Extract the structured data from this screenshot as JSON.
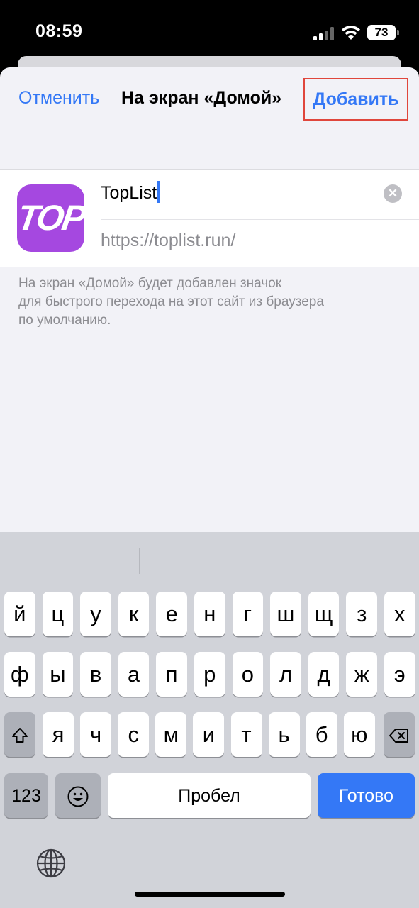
{
  "status_bar": {
    "time": "08:59",
    "battery": "73",
    "signal_icon": "signal-bars-icon",
    "wifi_icon": "wifi-icon"
  },
  "nav": {
    "cancel_label": "Отменить",
    "title": "На экран «Домой»",
    "add_label": "Добавить"
  },
  "form": {
    "app_icon_text": "TOP",
    "app_icon_color": "#a548e0",
    "name_value": "TopList",
    "url": "https://toplist.run/"
  },
  "note_lines": [
    "На экран «Домой» будет добавлен значок",
    "для быстрого перехода на этот сайт из браузера",
    "по умолчанию."
  ],
  "keyboard": {
    "row1": [
      "й",
      "ц",
      "у",
      "к",
      "е",
      "н",
      "г",
      "ш",
      "щ",
      "з",
      "х"
    ],
    "row2": [
      "ф",
      "ы",
      "в",
      "а",
      "п",
      "р",
      "о",
      "л",
      "д",
      "ж",
      "э"
    ],
    "row3": [
      "я",
      "ч",
      "с",
      "м",
      "и",
      "т",
      "ь",
      "б",
      "ю"
    ],
    "numbers_label": "123",
    "space_label": "Пробел",
    "done_label": "Готово",
    "accent_color": "#3478f6"
  }
}
